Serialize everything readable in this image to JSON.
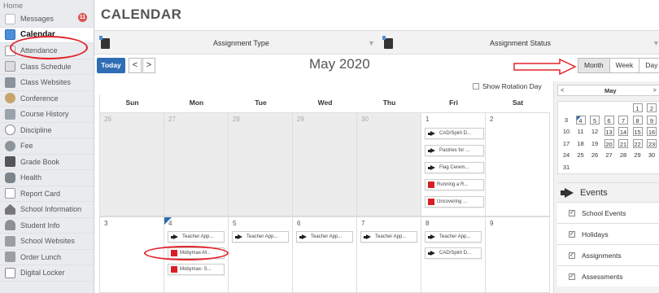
{
  "sidebar": {
    "home": "Home",
    "items": [
      {
        "label": "Messages",
        "icon": "envelope-icon",
        "badge": "11"
      },
      {
        "label": "Calendar",
        "icon": "calendar-icon",
        "active": true
      },
      {
        "label": "Attendance",
        "icon": "checkbox-icon"
      },
      {
        "label": "Class Schedule",
        "icon": "schedule-icon"
      },
      {
        "label": "Class Websites",
        "icon": "website-icon"
      },
      {
        "label": "Conference",
        "icon": "people-icon"
      },
      {
        "label": "Course History",
        "icon": "history-icon"
      },
      {
        "label": "Discipline",
        "icon": "alert-icon"
      },
      {
        "label": "Fee",
        "icon": "coins-icon"
      },
      {
        "label": "Grade Book",
        "icon": "gradebook-icon"
      },
      {
        "label": "Health",
        "icon": "health-icon"
      },
      {
        "label": "Report Card",
        "icon": "report-card-icon"
      },
      {
        "label": "School Information",
        "icon": "school-icon"
      },
      {
        "label": "Student Info",
        "icon": "student-icon"
      },
      {
        "label": "School Websites",
        "icon": "school-websites-icon"
      },
      {
        "label": "Order Lunch",
        "icon": "lunch-icon"
      },
      {
        "label": "Digital Locker",
        "icon": "locker-icon"
      }
    ]
  },
  "header": {
    "title": "CALENDAR"
  },
  "filters": {
    "assignment_type": "Assignment Type",
    "assignment_status": "Assignment Status"
  },
  "toolbar": {
    "today": "Today",
    "prev": "<",
    "next": ">",
    "month_title": "May 2020",
    "views": [
      "Month",
      "Week",
      "Day"
    ],
    "selected_view": "Month"
  },
  "show_rotation_day": "Show Rotation Day",
  "calendar": {
    "weekdays": [
      "Sun",
      "Mon",
      "Tue",
      "Wed",
      "Thu",
      "Fri",
      "Sat"
    ],
    "week1": [
      "26",
      "27",
      "28",
      "29",
      "30",
      "1",
      "2"
    ],
    "week2": [
      "3",
      "4",
      "5",
      "6",
      "7",
      "8",
      "9"
    ],
    "events_week1_fri": [
      {
        "text": "CAD/Spirit D...",
        "icon": "megaphone-icon"
      },
      {
        "text": "Pastries for ...",
        "icon": "megaphone-icon"
      },
      {
        "text": "Flag Cerem...",
        "icon": "megaphone-icon"
      },
      {
        "text": "Running a R...",
        "icon": "assignment-icon"
      },
      {
        "text": "Uncovering ...",
        "icon": "assignment-icon"
      }
    ],
    "events_week2": {
      "mon": [
        {
          "text": "Teacher App...",
          "icon": "megaphone-icon"
        },
        {
          "text": "Mobymax-M...",
          "icon": "assignment-icon"
        },
        {
          "text": "Mobymax- S...",
          "icon": "assignment-icon"
        }
      ],
      "tue": [
        {
          "text": "Teacher App...",
          "icon": "megaphone-icon"
        }
      ],
      "wed": [
        {
          "text": "Teacher App...",
          "icon": "megaphone-icon"
        }
      ],
      "thu": [
        {
          "text": "Teacher App...",
          "icon": "megaphone-icon"
        }
      ],
      "fri": [
        {
          "text": "Teacher App...",
          "icon": "megaphone-icon"
        },
        {
          "text": "CAD/Spirit D...",
          "icon": "megaphone-icon"
        }
      ]
    }
  },
  "mini_calendar": {
    "month": "May",
    "prev": "<",
    "next": ">",
    "rows": [
      [
        "",
        "",
        "",
        "",
        "",
        "1",
        "2"
      ],
      [
        "3",
        "4",
        "5",
        "6",
        "7",
        "8",
        "9"
      ],
      [
        "10",
        "11",
        "12",
        "13",
        "14",
        "15",
        "16"
      ],
      [
        "17",
        "18",
        "19",
        "20",
        "21",
        "22",
        "23"
      ],
      [
        "24",
        "25",
        "26",
        "27",
        "28",
        "29",
        "30"
      ],
      [
        "31",
        "",
        "",
        "",
        "",
        "",
        ""
      ]
    ]
  },
  "events_panel": {
    "title": "Events",
    "options": [
      "School Events",
      "Holidays",
      "Assignments",
      "Assessments"
    ]
  },
  "colors": {
    "accent": "#2f6db5",
    "annotation": "#e3232a",
    "assignment": "#d81f26"
  }
}
